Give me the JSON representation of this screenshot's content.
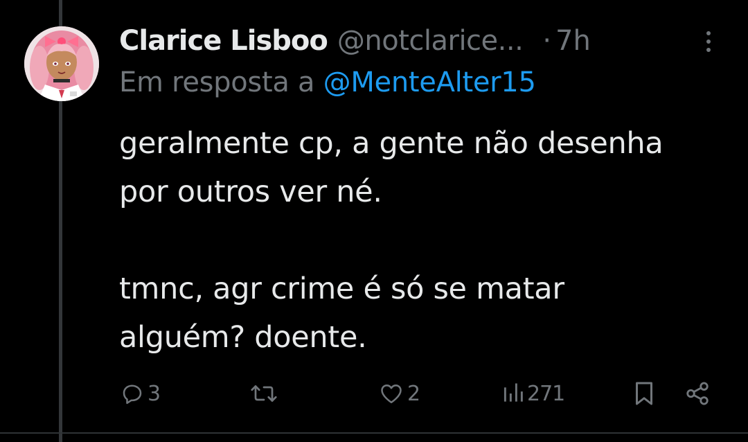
{
  "tweet": {
    "display_name": "Clarice Lisboo",
    "handle": "@notclarice...",
    "separator": "·",
    "time": "7h",
    "reply_prefix": "Em resposta a",
    "reply_mention": "@MenteAlter15",
    "text_lines": [
      "geralmente cp, a gente não desenha",
      "por outros ver né.",
      "tmnc, agr crime é só se matar",
      "alguém? doente."
    ],
    "avatar_icon": "avatar-anime-girl"
  },
  "actions": {
    "reply_count": "3",
    "retweet_count": "",
    "like_count": "2",
    "views_count": "271",
    "icons": {
      "reply": "speech-bubble-icon",
      "retweet": "retweet-arrows-icon",
      "like": "heart-outline-icon",
      "views": "bar-chart-icon",
      "bookmark": "bookmark-icon",
      "share": "share-nodes-icon",
      "more": "vertical-dots-icon"
    }
  },
  "colors": {
    "background": "#000000",
    "text": "#e7e9ea",
    "muted": "#71767b",
    "link": "#1d9bf0",
    "thread_line": "#333639"
  }
}
